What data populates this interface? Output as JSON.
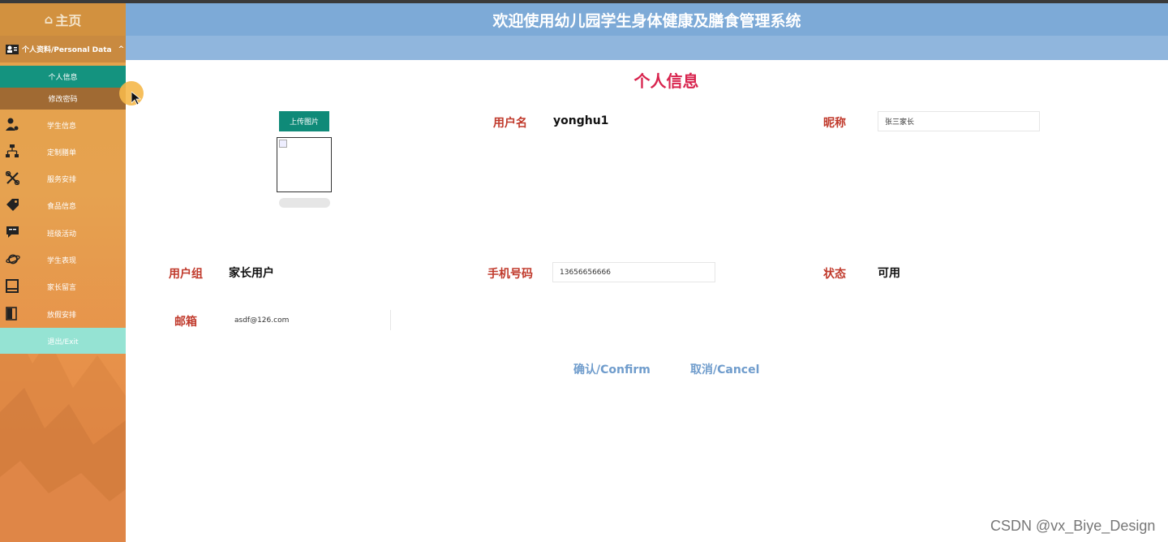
{
  "app": {
    "title": "欢迎使用幼儿园学生身体健康及膳食管理系统",
    "home_label": "主页",
    "home_icon": "home-icon"
  },
  "sidebar": {
    "section_label": "个人资料/Personal Data",
    "section_icon": "id-card-icon",
    "sub_items": [
      {
        "label": "个人信息",
        "active": true
      },
      {
        "label": "修改密码",
        "active": false
      }
    ],
    "items": [
      {
        "label": "学生信息",
        "icon": "user-gear-icon"
      },
      {
        "label": "定制膳单",
        "icon": "sitemap-icon"
      },
      {
        "label": "服务安排",
        "icon": "tools-icon"
      },
      {
        "label": "食品信息",
        "icon": "tag-icon"
      },
      {
        "label": "班级活动",
        "icon": "chat-icon"
      },
      {
        "label": "学生表现",
        "icon": "planet-icon"
      },
      {
        "label": "家长留言",
        "icon": "book-icon"
      },
      {
        "label": "放假安排",
        "icon": "door-icon"
      }
    ],
    "exit_label": "退出/Exit"
  },
  "main": {
    "page_title": "个人信息",
    "upload_label": "上传图片",
    "fields": {
      "username_label": "用户名",
      "username_value": "yonghu1",
      "nickname_label": "昵称",
      "nickname_value": "张三家长",
      "usergroup_label": "用户组",
      "usergroup_value": "家长用户",
      "phone_label": "手机号码",
      "phone_value": "13656656666",
      "status_label": "状态",
      "status_value": "可用",
      "email_label": "邮箱",
      "email_value": "asdf@126.com"
    },
    "confirm_label": "确认/Confirm",
    "cancel_label": "取消/Cancel"
  },
  "watermark": "CSDN @vx_Biye_Design",
  "colors": {
    "header": "#7daad7",
    "sidebar": "#e3a24a",
    "active_item": "#14937f",
    "exit": "#95e3d3",
    "title": "#d8244e",
    "label": "#c0392b",
    "action": "#6f9ccc"
  }
}
